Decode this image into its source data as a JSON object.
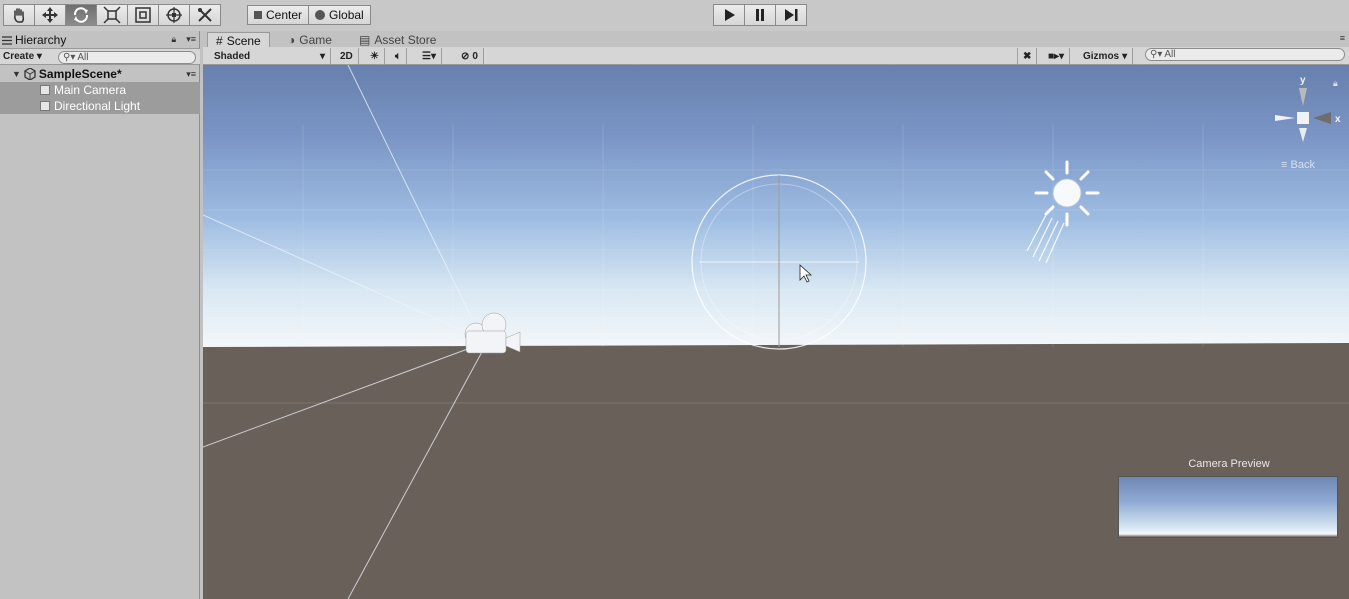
{
  "toolbar": {
    "tools": [
      "hand-tool",
      "move-tool",
      "rotate-tool",
      "scale-tool",
      "rect-tool",
      "transform-tool",
      "custom-tool"
    ],
    "pivot_label": "Center",
    "space_label": "Global",
    "playback": [
      "play",
      "pause",
      "step"
    ]
  },
  "hierarchy": {
    "tab_label": "Hierarchy",
    "create_label": "Create",
    "search_placeholder": "All",
    "scene_name": "SampleScene*",
    "items": [
      {
        "label": "Main Camera"
      },
      {
        "label": "Directional Light"
      }
    ]
  },
  "scene_view": {
    "tabs": [
      {
        "label": "Scene"
      },
      {
        "label": "Game"
      },
      {
        "label": "Asset Store"
      }
    ],
    "shading_mode": "Shaded",
    "mode_2d": "2D",
    "hidden_count": "0",
    "gizmos_label": "Gizmos",
    "search_placeholder": "All",
    "gizmo_y": "y",
    "gizmo_x": "x",
    "back_label": "Back",
    "camera_preview_label": "Camera Preview"
  },
  "colors": {
    "sky_top": "#6780ad",
    "horizon": "#dde9f2",
    "ground": "#6a605a",
    "selection_row": "#9c9c9c"
  }
}
